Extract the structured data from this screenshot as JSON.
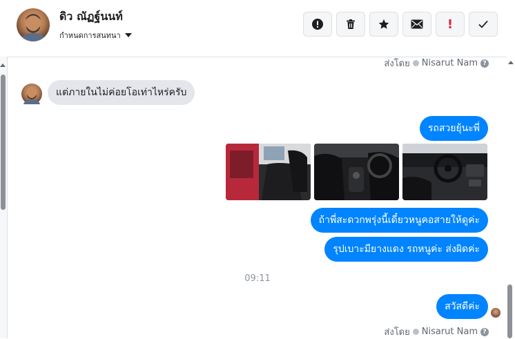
{
  "header": {
    "contact_name": "ดิว ณัฏฐ์นนท์",
    "label_select": "กำหนดการสนทนา",
    "tools": [
      {
        "icon": "alert-circle-icon"
      },
      {
        "icon": "trash-icon"
      },
      {
        "icon": "star-icon"
      },
      {
        "icon": "envelope-icon",
        "symbol": "✉"
      },
      {
        "icon": "exclamation-icon",
        "symbol": "!"
      },
      {
        "icon": "check-icon",
        "symbol": "✓"
      }
    ]
  },
  "conversation": {
    "sent_by_top": {
      "prefix": "ส่งโดย",
      "name": "Nisarut Nam"
    },
    "incoming_message": "แต่ภายในไม่ค่อยโอเท่าไหร่ครับ",
    "outgoing_message_1": "รถสวยยุ้นะพี่",
    "photos": [
      "car-door-interior",
      "car-front-seats",
      "car-dashboard"
    ],
    "outgoing_message_2": "ถ้าพี่สะดวกพรุ่งนี้เดี๋ยวหนูคอสายให้ดูค่ะ",
    "outgoing_message_3": "รุปเบาะมียางแดง รถหนูค่ะ ส่งผิดค่ะ",
    "timestamp": "09:11",
    "outgoing_message_4": "สวัสดีค่ะ",
    "sent_by_bottom": {
      "prefix": "ส่งโดย",
      "name": "Nisarut Nam"
    }
  },
  "colors": {
    "accent": "#0084ff",
    "incoming_bubble": "#e4e6eb",
    "muted_text": "#606770"
  }
}
